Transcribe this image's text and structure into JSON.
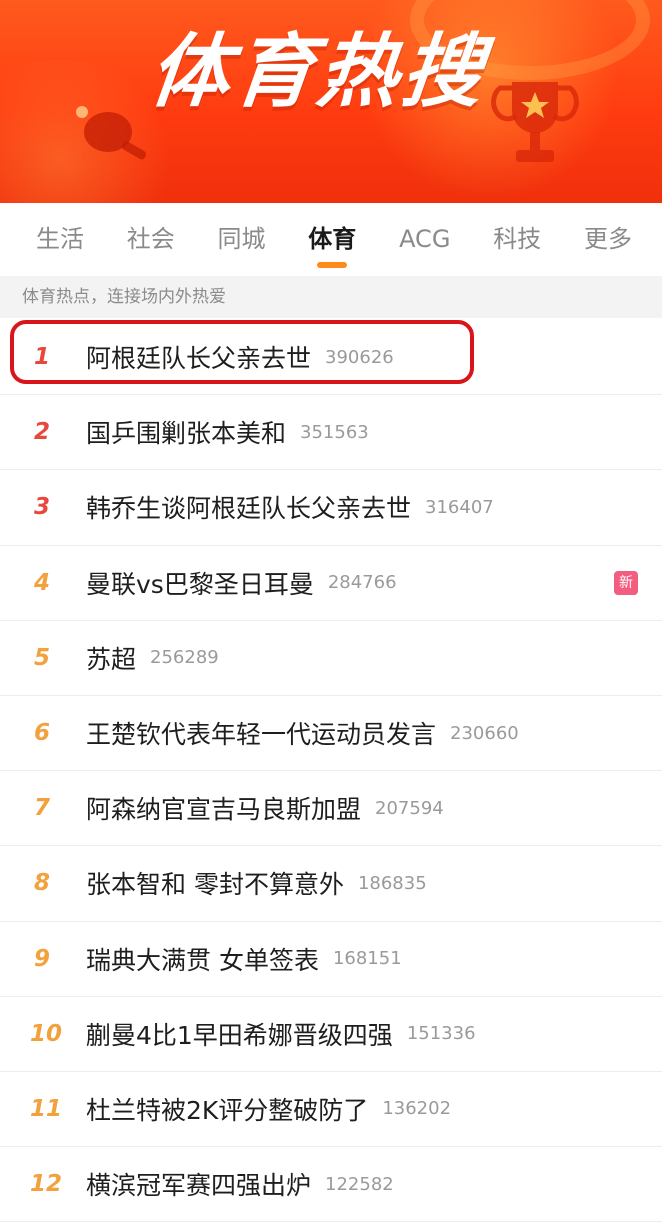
{
  "banner": {
    "title": "体育热搜"
  },
  "tabs": [
    {
      "label": "生活",
      "active": false
    },
    {
      "label": "社会",
      "active": false
    },
    {
      "label": "同城",
      "active": false
    },
    {
      "label": "体育",
      "active": true
    },
    {
      "label": "ACG",
      "active": false
    },
    {
      "label": "科技",
      "active": false
    },
    {
      "label": "更多",
      "active": false
    }
  ],
  "subtitle": "体育热点，连接场内外热爱",
  "items": [
    {
      "rank": "1",
      "title": "阿根廷队长父亲去世",
      "count": "390626",
      "badge": ""
    },
    {
      "rank": "2",
      "title": "国乒围剿张本美和",
      "count": "351563",
      "badge": ""
    },
    {
      "rank": "3",
      "title": "韩乔生谈阿根廷队长父亲去世",
      "count": "316407",
      "badge": ""
    },
    {
      "rank": "4",
      "title": "曼联vs巴黎圣日耳曼",
      "count": "284766",
      "badge": "新"
    },
    {
      "rank": "5",
      "title": "苏超",
      "count": "256289",
      "badge": ""
    },
    {
      "rank": "6",
      "title": "王楚钦代表年轻一代运动员发言",
      "count": "230660",
      "badge": ""
    },
    {
      "rank": "7",
      "title": "阿森纳官宣吉马良斯加盟",
      "count": "207594",
      "badge": ""
    },
    {
      "rank": "8",
      "title": "张本智和 零封不算意外",
      "count": "186835",
      "badge": ""
    },
    {
      "rank": "9",
      "title": "瑞典大满贯 女单签表",
      "count": "168151",
      "badge": ""
    },
    {
      "rank": "10",
      "title": "蒯曼4比1早田希娜晋级四强",
      "count": "151336",
      "badge": ""
    },
    {
      "rank": "11",
      "title": "杜兰特被2K评分整破防了",
      "count": "136202",
      "badge": ""
    },
    {
      "rank": "12",
      "title": "横滨冠军赛四强出炉",
      "count": "122582",
      "badge": ""
    }
  ],
  "colors": {
    "banner": "#ff3c10",
    "rank_top": "#e8483b",
    "rank_other": "#f2a13c",
    "tab_indicator": "#ff8a1c",
    "new_badge": "#f35d80",
    "highlight_circle": "#d9141a"
  },
  "icons": [
    "ping-pong-paddle-icon",
    "trophy-icon",
    "new-badge-icon"
  ]
}
